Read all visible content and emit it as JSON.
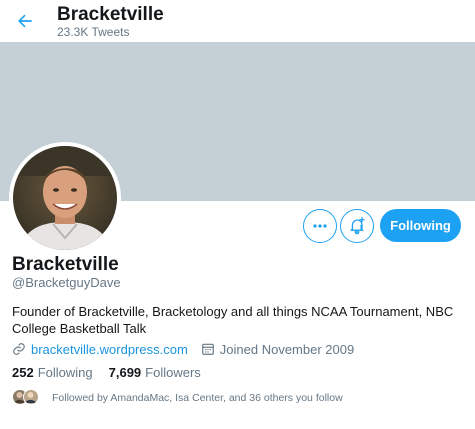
{
  "header": {
    "name": "Bracketville",
    "tweet_count": "23.3K Tweets",
    "back_icon": "arrow-left-icon"
  },
  "profile": {
    "display_name": "Bracketville",
    "handle": "@BracketguyDave",
    "bio": "Founder of Bracketville, Bracketology and all things NCAA Tournament, NBC College Basketball Talk",
    "website": "bracketville.wordpress.com",
    "joined": "Joined November 2009"
  },
  "actions": {
    "more_icon": "more-icon",
    "notify_icon": "bell-plus-icon",
    "follow_label": "Following"
  },
  "stats": {
    "following_count": "252",
    "following_label": "Following",
    "followers_count": "7,699",
    "followers_label": "Followers"
  },
  "followed_by": {
    "text": "Followed by AmandaMac, Isa Center, and 36 others you follow"
  },
  "colors": {
    "accent": "#1da1f2",
    "link": "#1b95e0",
    "banner": "#c4cfd6",
    "secondary_text": "#657786"
  }
}
